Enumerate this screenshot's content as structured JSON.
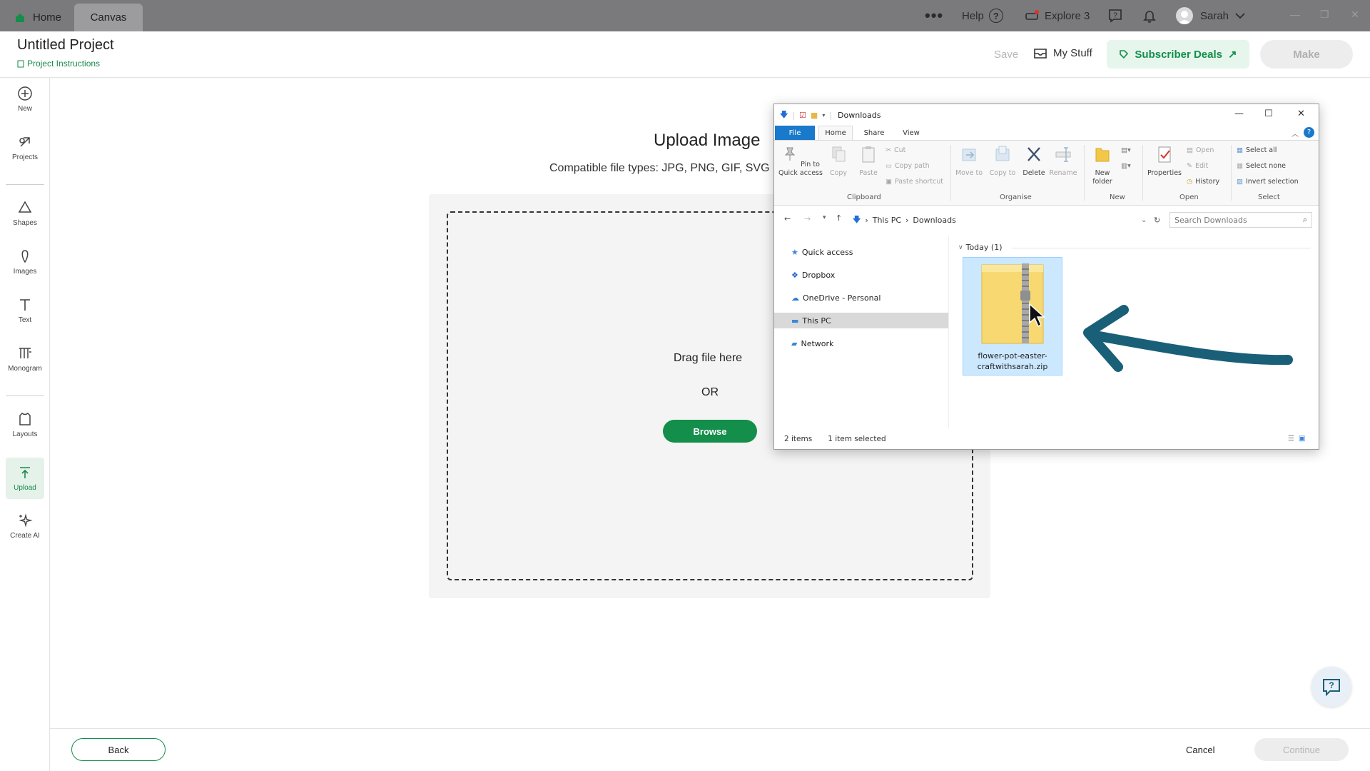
{
  "topbar": {
    "tabs": [
      {
        "label": "Home",
        "icon": "home-icon"
      },
      {
        "label": "Canvas"
      }
    ],
    "more_label": "•••",
    "help_label": "Help",
    "explore_label": "Explore 3",
    "user_name": "Sarah",
    "brand_color": "#138e4b"
  },
  "header": {
    "title": "Untitled Project",
    "instructions_link": "Project Instructions",
    "save_label": "Save",
    "mystuff_label": "My Stuff",
    "deals_label": "Subscriber Deals",
    "make_label": "Make"
  },
  "sidebar": {
    "items": [
      {
        "label": "New",
        "icon": "plus-circle-icon"
      },
      {
        "label": "Projects",
        "icon": "projects-icon"
      },
      {
        "label": "Shapes",
        "icon": "shapes-icon"
      },
      {
        "label": "Images",
        "icon": "images-icon"
      },
      {
        "label": "Text",
        "icon": "text-icon"
      },
      {
        "label": "Monogram",
        "icon": "monogram-icon"
      },
      {
        "label": "Layouts",
        "icon": "layouts-icon"
      },
      {
        "label": "Upload",
        "icon": "upload-icon",
        "active": true
      },
      {
        "label": "Create AI",
        "icon": "sparkle-icon"
      }
    ]
  },
  "upload": {
    "title": "Upload Image",
    "types": "Compatible file types:  JPG, PNG, GIF, SVG",
    "drag_text": "Drag file here",
    "or_text": "OR",
    "browse_label": "Browse"
  },
  "footer": {
    "back_label": "Back",
    "cancel_label": "Cancel",
    "continue_label": "Continue"
  },
  "explorer": {
    "title": "Downloads",
    "tabs": [
      "File",
      "Home",
      "Share",
      "View"
    ],
    "ribbon": {
      "clipboard": {
        "group": "Clipboard",
        "pin": "Pin to Quick access",
        "copy": "Copy",
        "paste": "Paste",
        "cut": "Cut",
        "copy_path": "Copy path",
        "paste_shortcut": "Paste shortcut"
      },
      "organise": {
        "group": "Organise",
        "move_to": "Move to",
        "copy_to": "Copy to",
        "delete": "Delete",
        "rename": "Rename"
      },
      "new": {
        "group": "New",
        "new_folder": "New folder"
      },
      "open": {
        "group": "Open",
        "properties": "Properties",
        "open": "Open",
        "edit": "Edit",
        "history": "History"
      },
      "select": {
        "group": "Select",
        "select_all": "Select all",
        "select_none": "Select none",
        "invert": "Invert selection"
      }
    },
    "address": {
      "root": "This PC",
      "folder": "Downloads"
    },
    "search_placeholder": "Search Downloads",
    "nav": [
      {
        "label": "Quick access",
        "icon": "star-icon"
      },
      {
        "label": "Dropbox",
        "icon": "dropbox-icon"
      },
      {
        "label": "OneDrive - Personal",
        "icon": "cloud-icon"
      },
      {
        "label": "This PC",
        "icon": "computer-icon",
        "selected": true
      },
      {
        "label": "Network",
        "icon": "network-icon"
      }
    ],
    "group_label": "Today (1)",
    "file_name": "flower-pot-easter-craftwithsarah.zip",
    "status_items": "2 items",
    "status_selected": "1 item selected"
  },
  "annotation": {
    "arrow_color": "#1a5f78"
  }
}
